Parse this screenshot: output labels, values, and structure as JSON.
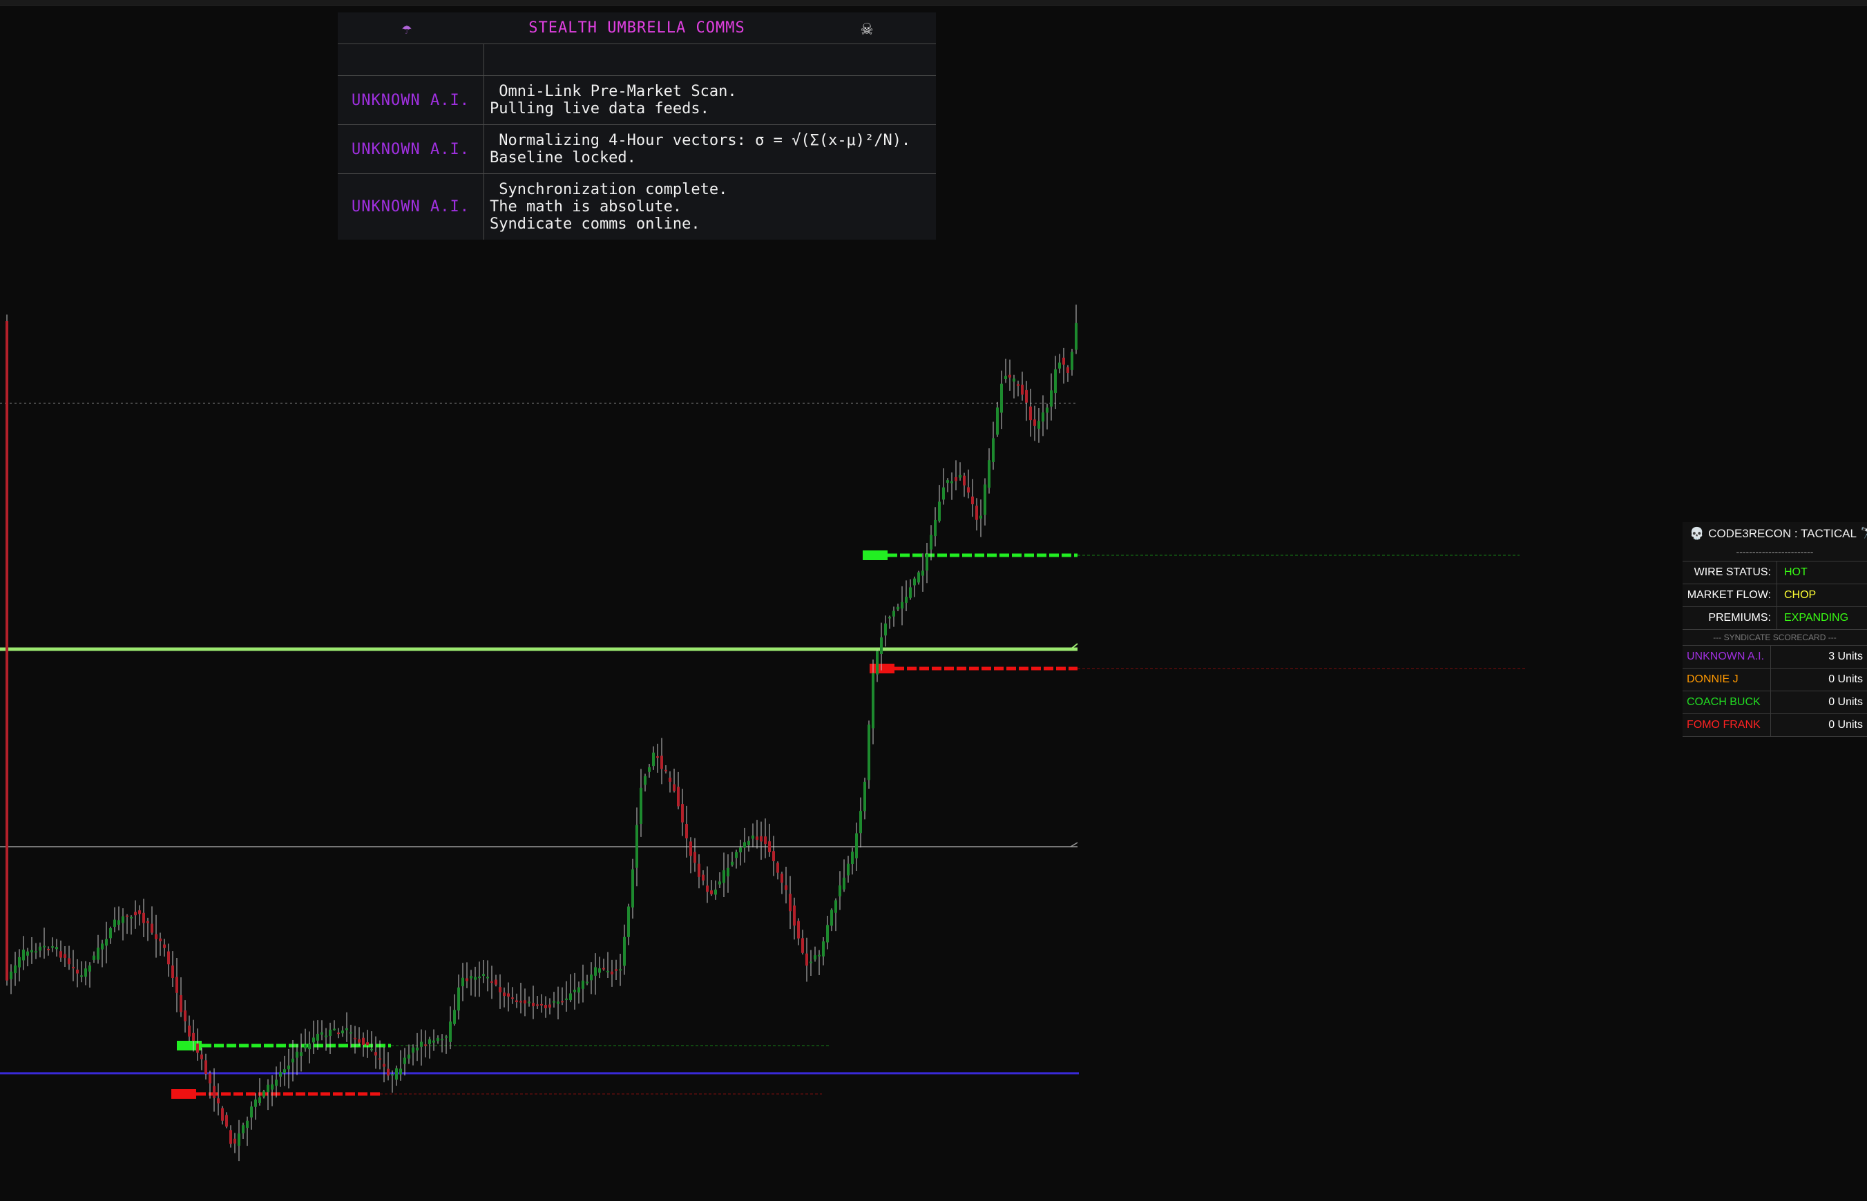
{
  "comms": {
    "title": "STEALTH UMBRELLA COMMS",
    "umbrella_icon": "☂",
    "skull_icon": "☠",
    "messages": [
      {
        "sender": "UNKNOWN A.I.",
        "text": " Omni-Link Pre-Market Scan.\nPulling live data feeds."
      },
      {
        "sender": "UNKNOWN A.I.",
        "text": " Normalizing 4-Hour vectors: σ = √(Σ(x-μ)²/N).\nBaseline locked."
      },
      {
        "sender": "UNKNOWN A.I.",
        "text": " Synchronization complete.\nThe math is absolute.\nSyndicate comms online."
      }
    ]
  },
  "tactical": {
    "title": "CODE3RECON : TACTICAL",
    "skull_icon": "💀",
    "scope_icon": "🔭",
    "separator": "------------------------",
    "wire_status": {
      "label": "WIRE STATUS:",
      "value": "HOT",
      "color": "#39ff14"
    },
    "market_flow": {
      "label": "MARKET FLOW:",
      "value": "CHOP",
      "color": "#ffff33"
    },
    "premiums": {
      "label": "PREMIUMS:",
      "value": "EXPANDING",
      "color": "#39ff14"
    },
    "scorecard_title": "--- SYNDICATE SCORECARD ---",
    "scorecard": [
      {
        "name": "UNKNOWN A.I.",
        "units": "3 Units",
        "color": "#a030e0"
      },
      {
        "name": "DONNIE J",
        "units": "0 Units",
        "color": "#ff9900"
      },
      {
        "name": "COACH BUCK",
        "units": "0 Units",
        "color": "#22dd22"
      },
      {
        "name": "FOMO FRANK",
        "units": "0 Units",
        "color": "#ff2222"
      }
    ]
  },
  "colors": {
    "bull": "#1d8a2e",
    "bear": "#b3202a",
    "wick": "#c8c8c8",
    "green_zone": "#22ee22",
    "red_zone": "#ee1111",
    "lime_line": "#9be870",
    "blue_line": "#3a2ad8"
  }
}
